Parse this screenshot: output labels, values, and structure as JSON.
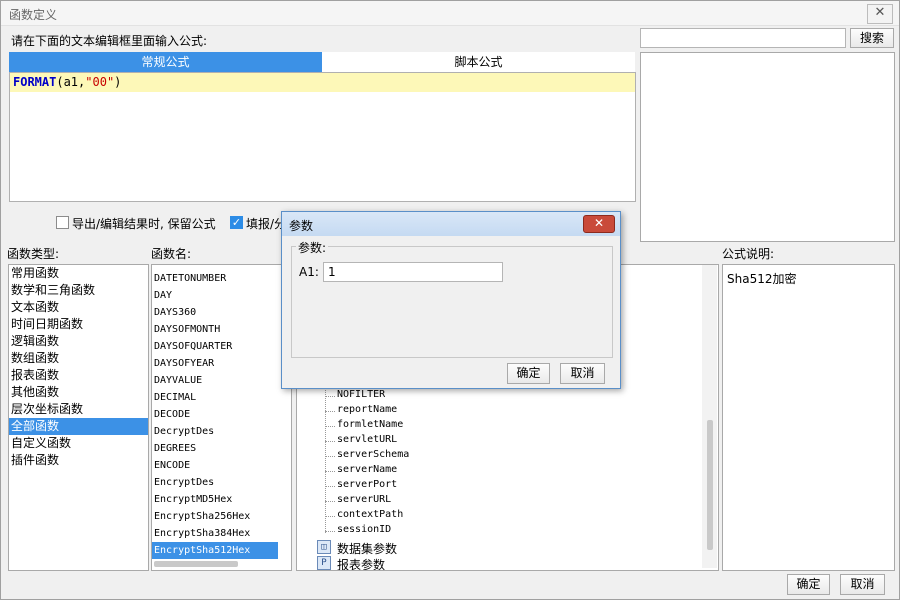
{
  "window": {
    "title": "函数定义",
    "close_icon": "close-icon"
  },
  "editor": {
    "prompt": "请在下面的文本编辑框里面输入公式:",
    "tabs": [
      {
        "label": "常规公式",
        "active": true
      },
      {
        "label": "脚本公式",
        "active": false
      }
    ],
    "formula": {
      "fn": "FORMAT",
      "open": "(a1,",
      "str": "\"00\"",
      "close": ")"
    }
  },
  "search": {
    "value": "",
    "button_label": "搜索"
  },
  "options": [
    {
      "label": "导出/编辑结果时, 保留公式",
      "checked": false
    },
    {
      "label": "填报/分",
      "checked": true
    }
  ],
  "categories": {
    "header": "函数类型:",
    "items": [
      "常用函数",
      "数学和三角函数",
      "文本函数",
      "时间日期函数",
      "逻辑函数",
      "数组函数",
      "报表函数",
      "其他函数",
      "层次坐标函数",
      "全部函数",
      "自定义函数",
      "插件函数"
    ],
    "selected_index": 9
  },
  "functions": {
    "header": "函数名:",
    "items": [
      "DATETONUMBER",
      "DAY",
      "DAYS360",
      "DAYSOFMONTH",
      "DAYSOFQUARTER",
      "DAYSOFYEAR",
      "DAYVALUE",
      "DECIMAL",
      "DECODE",
      "DecryptDes",
      "DEGREES",
      "ENCODE",
      "EncryptDes",
      "EncryptMD5Hex",
      "EncryptSha256Hex",
      "EncryptSha384Hex",
      "EncryptSha512Hex"
    ],
    "selected_index": 16
  },
  "params_tree": {
    "items": [
      "NOFILTER",
      "reportName",
      "formletName",
      "servletURL",
      "serverSchema",
      "serverName",
      "serverPort",
      "serverURL",
      "contextPath",
      "sessionID"
    ],
    "groups": [
      {
        "label": "数据集参数",
        "icon": "dataset-param-icon"
      },
      {
        "label": "报表参数",
        "icon": "report-param-icon",
        "badge": "P"
      }
    ]
  },
  "description": {
    "header": "公式说明:",
    "text": "Sha512加密"
  },
  "dialog": {
    "title": "参数",
    "group_label": "参数:",
    "field_label": "A1:",
    "field_value": "1",
    "ok_label": "确定",
    "cancel_label": "取消"
  },
  "footer": {
    "ok_label": "确定",
    "cancel_label": "取消"
  }
}
